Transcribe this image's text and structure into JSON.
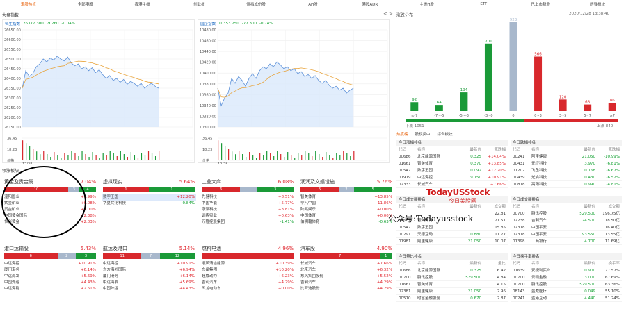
{
  "nav": {
    "tabs": [
      "港股热点",
      "全部港股",
      "香港主板",
      "创业板",
      "恒指成份股",
      "AH股",
      "港股ADR",
      "主板H股",
      "ETF",
      "已上市新股",
      "所有板块"
    ],
    "active_index": 0
  },
  "market": {
    "title": "大盘指数",
    "hsi": {
      "name": "恒生指数",
      "value": "26377.300",
      "change": "-9.260",
      "pct": "-0.04%"
    },
    "hscei": {
      "name": "国企指数",
      "value": "10353.250",
      "change": "-77.300",
      "pct": "-0.74%"
    },
    "hsi_axis": [
      "26650.00",
      "26600.00",
      "26550.00",
      "26500.00",
      "26450.00",
      "26400.00",
      "26350.00",
      "26300.00",
      "26250.00",
      "26200.00",
      "26150.00"
    ],
    "hscei_axis": [
      "10480.00",
      "10460.00",
      "10440.00",
      "10420.00",
      "10400.00",
      "10380.00",
      "10360.00",
      "10340.00",
      "10320.00",
      "10300.00"
    ],
    "vol_axis": [
      "36.45",
      "18.23",
      "价格"
    ],
    "date": "12/28"
  },
  "distribution": {
    "title": "涨跌分布",
    "timestamp": "2020/12/28 13:38:40",
    "fall_label": "下跌 1051",
    "rise_label": "上涨 840",
    "collapse_glyph": "<",
    "expand_glyph": ">"
  },
  "chart_data": {
    "type": "bar",
    "categories": [
      "≤-7",
      "-7~-5",
      "-5~-3",
      "-3~0",
      "0",
      "0~3",
      "3~5",
      "5~7",
      "≥7"
    ],
    "values": [
      92,
      64,
      194,
      701,
      923,
      566,
      120,
      68,
      86
    ],
    "colors": [
      "#1a9a38",
      "#1a9a38",
      "#1a9a38",
      "#1a9a38",
      "#a8b8cc",
      "#d8282c",
      "#d8282c",
      "#d8282c",
      "#d8282c"
    ],
    "ylim": [
      0,
      923
    ]
  },
  "hot": {
    "tabs": [
      "热度榜",
      "股权类中",
      "综合板块"
    ],
    "active_index": 0,
    "left": [
      {
        "title": "今日涨幅排名",
        "cols": [
          "代码",
          "名称",
          "最新价",
          "涨跌幅"
        ],
        "rows": [
          [
            "00686",
            "北京能源国际",
            "0.325",
            "+14.04%"
          ],
          [
            "01661",
            "智美体育",
            "0.370",
            "+13.85%"
          ],
          [
            "00547",
            "数字王国",
            "0.092",
            "+12.20%"
          ],
          [
            "01919",
            "中远海控",
            "9.150",
            "+10.91%"
          ],
          [
            "02333",
            "长城汽车",
            "",
            "+7.66%"
          ]
        ]
      },
      {
        "title": "今日成交额排名",
        "cols": [
          "代码",
          "名称",
          "最新价",
          "成交额"
        ],
        "rows": [
          [
            "",
            "",
            "",
            "22.81"
          ],
          [
            "01661",
            "智美体育",
            "",
            "21.51"
          ],
          [
            "00547",
            "数字王国",
            "",
            "15.85"
          ],
          [
            "00291",
            "天德互动",
            "0.880",
            "11.77"
          ],
          [
            "01981",
            "阿里健康",
            "21.050",
            "10.07"
          ]
        ]
      },
      {
        "title": "今日量比排名",
        "cols": [
          "代码",
          "名称",
          "最新价",
          "量比"
        ],
        "rows": [
          [
            "00686",
            "北京能源国际",
            "0.325",
            "6.42"
          ],
          [
            "00700",
            "腾讯控股",
            "529.500",
            "4.84"
          ],
          [
            "01661",
            "智美体育",
            "",
            "4.15"
          ],
          [
            "02381",
            "阿里健康",
            "21.050",
            "2.96"
          ],
          [
            "00510",
            "时富金融服务…",
            "0.670",
            "2.87"
          ]
        ]
      }
    ],
    "right": [
      {
        "title": "今日跌幅排名",
        "cols": [
          "代码",
          "名称",
          "最新价",
          "涨跌幅"
        ],
        "rows": [
          [
            "00241",
            "阿里健康",
            "21.050",
            "-10.99%"
          ],
          [
            "00431",
            "元征科技",
            "3.970",
            "-6.81%"
          ],
          [
            "01202",
            "飞鱼科技",
            "0.168",
            "-6.67%"
          ],
          [
            "00439",
            "光启科技",
            "0.430",
            "-6.52%"
          ],
          [
            "00818",
            "高阳科技",
            "0.990",
            "-4.81%"
          ]
        ]
      },
      {
        "title": "今日成交额排名",
        "cols": [
          "代码",
          "名称",
          "最新价",
          "成交额"
        ],
        "rows": [
          [
            "00700",
            "腾讯控股",
            "529.500",
            "196.75亿"
          ],
          [
            "02238",
            "吉利汽车",
            "24.500",
            "18.50亿"
          ],
          [
            "02318",
            "中国平安",
            "",
            "16.40亿"
          ],
          [
            "02318",
            "中国平安",
            "93.550",
            "13.55亿"
          ],
          [
            "01398",
            "工商银行",
            "4.700",
            "11.69亿"
          ]
        ]
      },
      {
        "title": "今日换手率排名",
        "cols": [
          "代码",
          "名称",
          "最新价",
          "换手率"
        ],
        "rows": [
          [
            "01639",
            "安捷利实业",
            "0.900",
            "77.57%"
          ],
          [
            "00700",
            "云硕金融",
            "3.000",
            "67.69%"
          ],
          [
            "00700",
            "腾讯控股",
            "529.500",
            "63.36%"
          ],
          [
            "08143",
            "金威医疗",
            "0.049",
            "55.10%"
          ],
          [
            "00241",
            "蓝港互动",
            "4.440",
            "51.24%"
          ]
        ]
      }
    ]
  },
  "sectors": {
    "title": "领涨板块",
    "list": [
      {
        "name": "黄金及贵金属",
        "pct": "7.04%",
        "bar": [
          [
            "10",
            70,
            "#d8282c"
          ],
          [
            "3",
            12,
            "#a8b8cc"
          ],
          [
            "4",
            18,
            "#1a9a38"
          ]
        ],
        "items": [
          [
            "潼阳国业",
            "+6.99%",
            "red",
            false
          ],
          [
            "紫金矿业",
            "+6.08%",
            "red",
            false
          ],
          [
            "灵金矿业",
            "+4.00%",
            "red",
            false
          ],
          [
            "中国黄金国际",
            "+2.38%",
            "red",
            false
          ],
          [
            "恒兴黄金",
            "+2.03%",
            "red",
            false
          ]
        ]
      },
      {
        "name": "虚拟现实",
        "pct": "5.64%",
        "bar": [
          [
            "1",
            50,
            "#d8282c"
          ],
          [
            "1",
            50,
            "#1a9a38"
          ]
        ],
        "items": [
          [
            "数字王国",
            "+12.20%",
            "red",
            true
          ],
          [
            "华夏文化科技",
            "-0.84%",
            "green",
            false
          ]
        ]
      },
      {
        "name": "工业大麻",
        "pct": "6.08%",
        "bar": [
          [
            "6",
            42,
            "#d8282c"
          ],
          [
            "",
            18,
            "#a8b8cc"
          ],
          [
            "3",
            40,
            "#1a9a38"
          ]
        ],
        "items": [
          [
            "先健科技",
            "+8.51%",
            "red",
            false
          ],
          [
            "中国华能",
            "+5.77%",
            "red",
            false
          ],
          [
            "康泽科技",
            "+3.81%",
            "red",
            false
          ],
          [
            "训练实业",
            "+0.63%",
            "red",
            false
          ],
          [
            "万隆控股集团",
            "-1.41%",
            "green",
            false
          ]
        ]
      },
      {
        "name": "润润及文娱设施",
        "pct": "5.76%",
        "bar": [
          [
            "5",
            42,
            "#d8282c"
          ],
          [
            "2",
            16,
            "#a8b8cc"
          ],
          [
            "5",
            42,
            "#1a9a38"
          ]
        ],
        "items": [
          [
            "智美体育",
            "+13.85%",
            "red",
            false
          ],
          [
            "非凡中国",
            "+11.86%",
            "red",
            false
          ],
          [
            "陆兆娱乐",
            "+0.00%",
            "red",
            false
          ],
          [
            "中国体育",
            "+0.00%",
            "red",
            false
          ],
          [
            "伯明翰体育",
            "-0.63%",
            "green",
            false
          ]
        ]
      },
      {
        "name": "港口运输股",
        "pct": "5.43%",
        "bar": [
          [
            "6",
            58,
            "#d8282c"
          ],
          [
            "2",
            20,
            "#a8b8cc"
          ],
          [
            "3",
            22,
            "#1a9a38"
          ]
        ],
        "items": [
          [
            "中远海控",
            "+10.91%",
            "red",
            false
          ],
          [
            "厦门港务",
            "+6.14%",
            "red",
            false
          ],
          [
            "中远海发",
            "+5.69%",
            "red",
            false
          ],
          [
            "中国外运",
            "+4.43%",
            "red",
            false
          ],
          [
            "中远海能",
            "+2.61%",
            "red",
            false
          ]
        ]
      },
      {
        "name": "航运及港口",
        "pct": "5.14%",
        "bar": [
          [
            "11",
            42,
            "#d8282c"
          ],
          [
            "7",
            20,
            "#a8b8cc"
          ],
          [
            "12",
            38,
            "#1a9a38"
          ]
        ],
        "items": [
          [
            "中远海控",
            "+10.91%",
            "red",
            false
          ],
          [
            "东方海外国际",
            "+6.94%",
            "red",
            false
          ],
          [
            "厦门港务",
            "+6.14%",
            "red",
            false
          ],
          [
            "中远海发",
            "+5.69%",
            "red",
            false
          ],
          [
            "中国外运",
            "+4.43%",
            "red",
            false
          ]
        ]
      },
      {
        "name": "燃料电池",
        "pct": "4.96%",
        "bar": [
          [
            "",
            100,
            "#d8282c"
          ]
        ],
        "items": [
          [
            "顺风清洁能源",
            "+10.39%",
            "red",
            false
          ],
          [
            "东岳集团",
            "+10.20%",
            "red",
            false
          ],
          [
            "超威动力",
            "+6.23%",
            "red",
            false
          ],
          [
            "吉利汽车",
            "+4.29%",
            "red",
            false
          ],
          [
            "五龙电动车",
            "+0.00%",
            "red",
            false
          ]
        ]
      },
      {
        "name": "汽车股",
        "pct": "4.90%",
        "bar": [
          [
            "7",
            86,
            "#d8282c"
          ],
          [
            "1",
            14,
            "#1a9a38"
          ]
        ],
        "items": [
          [
            "长城汽车",
            "+7.66%",
            "red",
            false
          ],
          [
            "北京汽车",
            "+6.32%",
            "red",
            false
          ],
          [
            "东风集团股份",
            "+5.52%",
            "red",
            false
          ],
          [
            "吉利汽车",
            "+4.29%",
            "red",
            false
          ],
          [
            "比亚迪股份",
            "+4.29%",
            "red",
            false
          ]
        ]
      }
    ]
  },
  "watermark": {
    "brand": "TodayUSStock",
    "brand_cn": "今日美股网",
    "wechat": "公众号:Todayusstock"
  }
}
